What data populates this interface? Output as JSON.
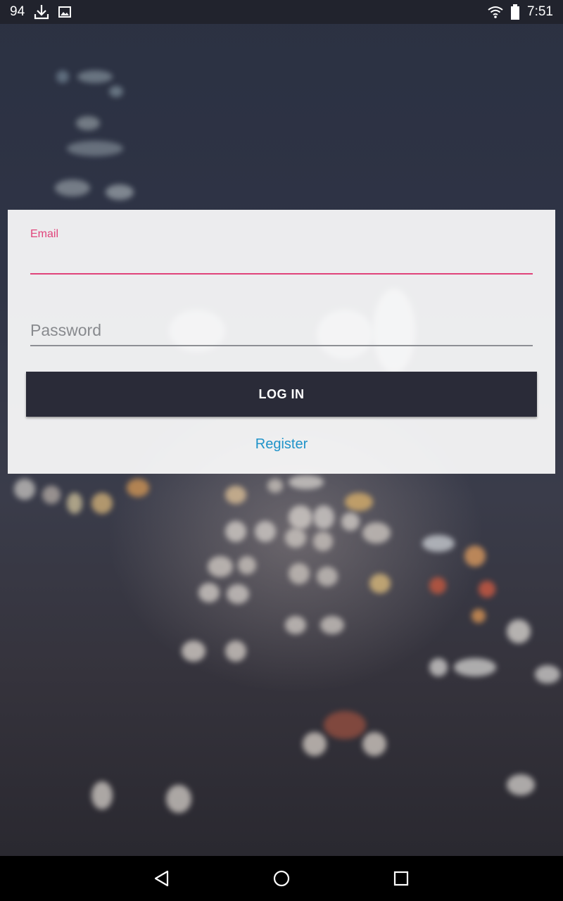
{
  "status_bar": {
    "notification_count": "94",
    "left_icons": [
      "download-icon",
      "image-icon"
    ],
    "right_icons": [
      "wifi-icon",
      "battery-icon"
    ],
    "time": "7:51"
  },
  "login_form": {
    "email_label": "Email",
    "email_value": "",
    "password_placeholder": "Password",
    "password_value": "",
    "login_button_label": "LOG IN",
    "register_link_label": "Register"
  },
  "nav_bar": {
    "buttons": [
      "back-icon",
      "home-icon",
      "recents-icon"
    ]
  },
  "colors": {
    "accent": "#e0437a",
    "link": "#1f93c9",
    "button_bg": "#2a2b38",
    "status_bar_bg": "#21232d",
    "nav_bar_bg": "#000000"
  }
}
